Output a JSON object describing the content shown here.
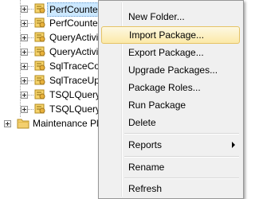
{
  "tree": {
    "packages": [
      {
        "label": "PerfCounterCol",
        "selected": true
      },
      {
        "label": "PerfCounterU",
        "selected": false
      },
      {
        "label": "QueryActivit",
        "selected": false
      },
      {
        "label": "QueryActivi",
        "selected": false
      },
      {
        "label": "SqlTraceCol",
        "selected": false
      },
      {
        "label": "SqlTraceUpl",
        "selected": false
      },
      {
        "label": "TSQLQueryC",
        "selected": false
      },
      {
        "label": "TSQLQueryU",
        "selected": false
      }
    ],
    "folder": {
      "label": "Maintenance Pl"
    }
  },
  "context_menu": {
    "items": [
      {
        "label": "New Folder..."
      },
      {
        "label": "Import Package...",
        "highlighted": true
      },
      {
        "label": "Export Package..."
      },
      {
        "label": "Upgrade Packages..."
      },
      {
        "label": "Package Roles..."
      },
      {
        "label": "Run Package"
      },
      {
        "label": "Delete"
      },
      {
        "label": "Reports",
        "submenu": true
      },
      {
        "label": "Rename"
      },
      {
        "label": "Refresh"
      }
    ]
  },
  "colors": {
    "menu_background": "#f0f0f0",
    "highlight_top": "#fdf8e2",
    "highlight_bottom": "#fbe9a8",
    "selection": "#cce8ff"
  }
}
